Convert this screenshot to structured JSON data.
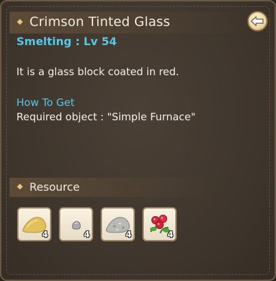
{
  "item": {
    "title": "Crimson Tinted Glass",
    "smelting_label": "Smelting : Lv 54",
    "description": "It is a glass block coated in red.",
    "how_to_get_label": "How To Get",
    "required_object": "Required object : \"Simple Furnace\""
  },
  "resource": {
    "title": "Resource",
    "items": [
      {
        "icon": "sand-pile-icon",
        "qty": "4"
      },
      {
        "icon": "stone-icon",
        "qty": "4"
      },
      {
        "icon": "gravel-pile-icon",
        "qty": "4"
      },
      {
        "icon": "red-berry-icon",
        "qty": "4"
      }
    ]
  },
  "colors": {
    "accent_cyan": "#56c8e8",
    "panel_bg": "#3d342b",
    "text": "#f4f0ea"
  }
}
